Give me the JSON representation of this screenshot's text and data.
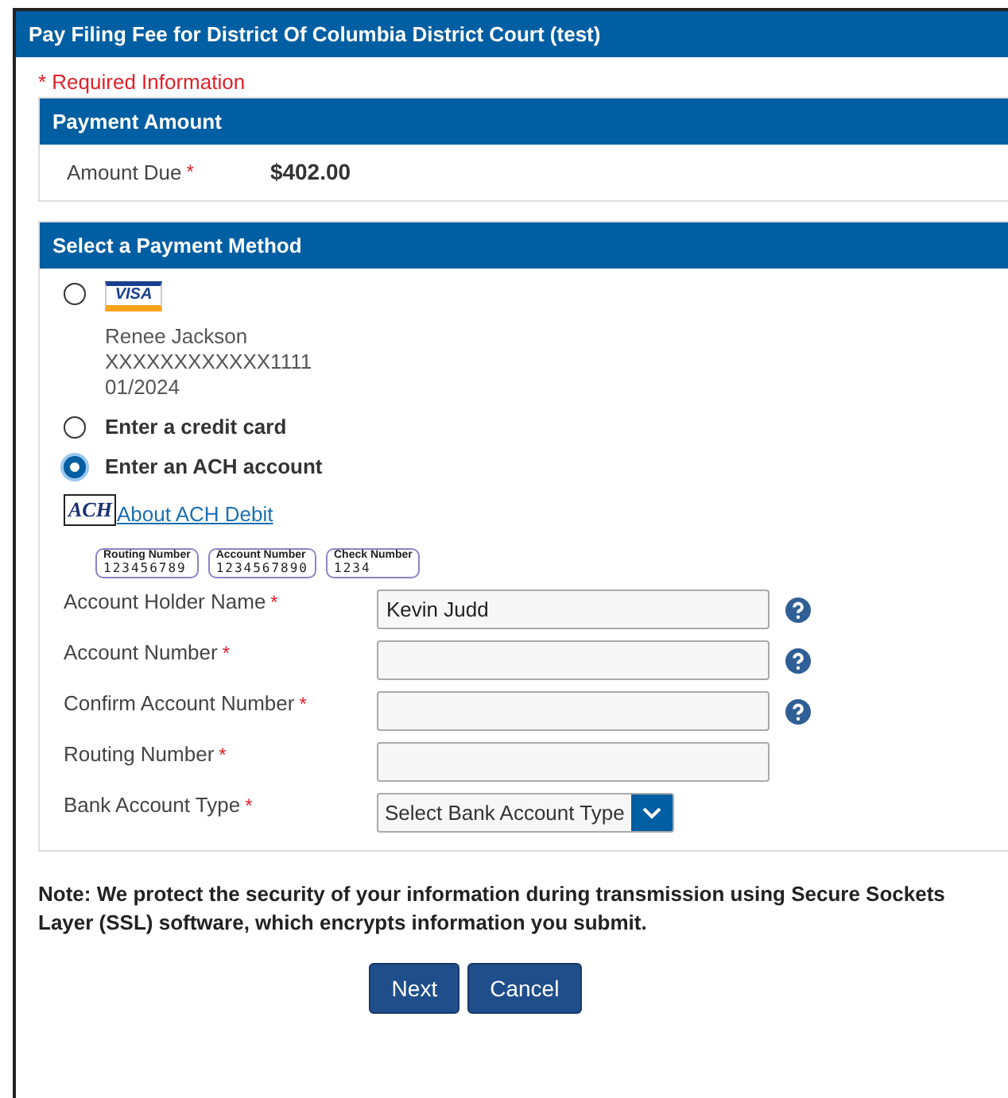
{
  "window": {
    "title": "Pay Filing Fee for District Of Columbia District Court (test)"
  },
  "required_note": "* Required Information",
  "payment_amount": {
    "title": "Payment Amount",
    "label": "Amount Due",
    "mark": "*",
    "value": "$402.00"
  },
  "payment_method": {
    "title": "Select a Payment Method",
    "options": [
      {
        "kind": "card",
        "selected": false,
        "brand": "VISA",
        "lines": [
          "Renee Jackson",
          "XXXXXXXXXXXX1111",
          "01/2024"
        ]
      },
      {
        "kind": "plain",
        "selected": false,
        "label": "Enter a credit card"
      },
      {
        "kind": "plain",
        "selected": true,
        "label": "Enter an ACH account"
      }
    ],
    "ach": {
      "logo": "ACH",
      "link": "About ACH Debit"
    },
    "check": [
      {
        "label": "Routing Number",
        "digits": "123456789"
      },
      {
        "label": "Account Number",
        "digits": "1234567890"
      },
      {
        "label": "Check Number",
        "digits": "1234"
      }
    ],
    "fields": [
      {
        "kind": "text",
        "label": "Account Holder Name",
        "mark": "*",
        "value": "Kevin Judd",
        "help": true
      },
      {
        "kind": "text",
        "label": "Account Number",
        "mark": "*",
        "help": true
      },
      {
        "kind": "text",
        "label": "Confirm Account Number",
        "mark": "*",
        "help": true
      },
      {
        "kind": "text",
        "label": "Routing Number",
        "mark": "*",
        "help": false
      },
      {
        "kind": "select",
        "label": "Bank Account Type",
        "mark": "*",
        "value": "Select Bank Account Type",
        "help": false
      }
    ]
  },
  "note": "**Note: We protect the security of your information during transmission using Secure Sockets Layer (SSL) software, which encrypts information you submit.**",
  "buttons": [
    "Next",
    "Cancel"
  ]
}
